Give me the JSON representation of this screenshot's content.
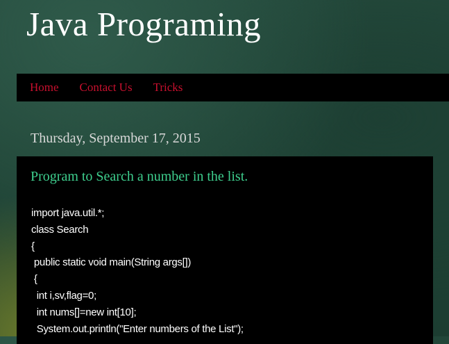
{
  "header": {
    "title": "Java Programing"
  },
  "nav": {
    "items": [
      {
        "label": "Home"
      },
      {
        "label": "Contact Us"
      },
      {
        "label": "Tricks"
      }
    ]
  },
  "post": {
    "date": "Thursday, September 17, 2015",
    "title": "Program to Search a number in the list.",
    "code_lines": [
      "import java.util.*;",
      "class Search",
      "{",
      " public static void main(String args[])",
      " {",
      "  int i,sv,flag=0;",
      "  int nums[]=new int[10];",
      "  System.out.println(\"Enter numbers of the List\");"
    ]
  },
  "colors": {
    "nav_link": "#c8102e",
    "post_title": "#3ecf8e",
    "background": "#1f4335"
  }
}
